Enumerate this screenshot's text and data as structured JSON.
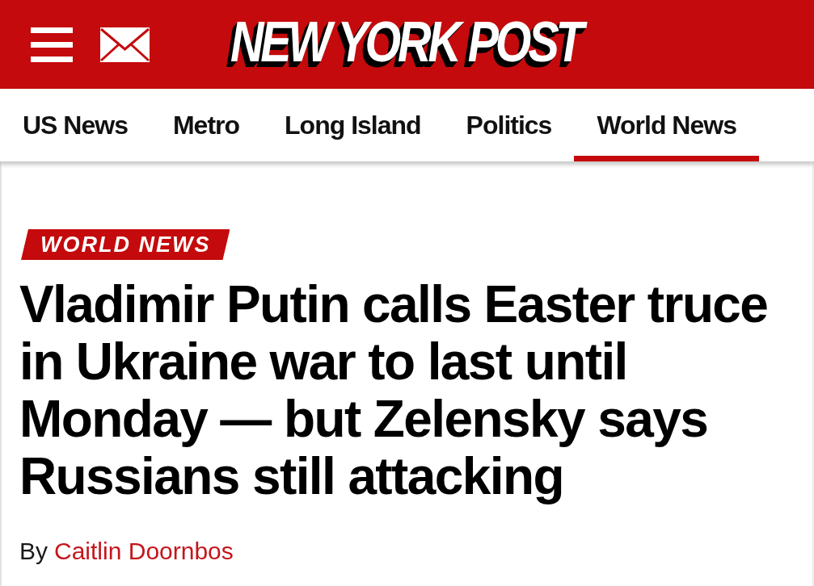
{
  "header": {
    "logo": "NEW YORK POST"
  },
  "nav": {
    "tabs": [
      {
        "label": "US News",
        "selected": false
      },
      {
        "label": "Metro",
        "selected": false
      },
      {
        "label": "Long Island",
        "selected": false
      },
      {
        "label": "Politics",
        "selected": false
      },
      {
        "label": "World News",
        "selected": true
      }
    ]
  },
  "article": {
    "category": "WORLD NEWS",
    "headline": "Vladimir Putin calls Easter truce in Ukraine war to last until Monday — but Zelensky says Russians still attacking",
    "byline": {
      "prefix": "By",
      "author": "Caitlin Doornbos"
    }
  }
}
